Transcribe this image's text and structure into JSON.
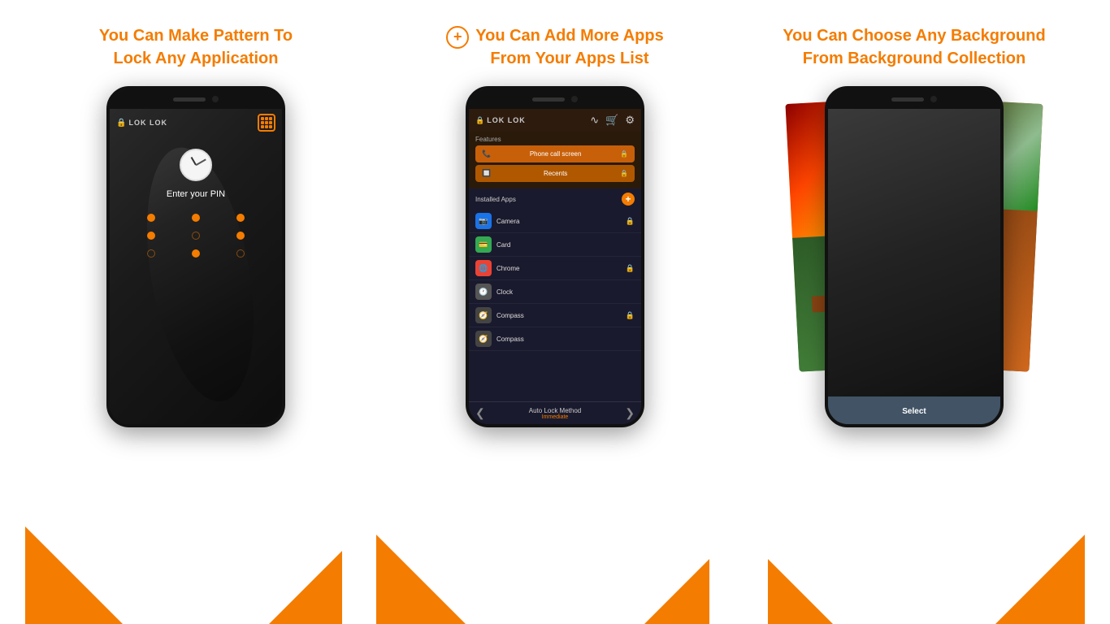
{
  "col1": {
    "title_line1": "You Can Make Pattern To",
    "title_line2": "Lock Any Application",
    "phone": {
      "app_name": "LOK LOK",
      "pin_prompt": "Enter your PIN",
      "dots": [
        "filled",
        "filled",
        "filled",
        "empty",
        "empty",
        "filled",
        "empty",
        "empty",
        "empty"
      ]
    }
  },
  "col2": {
    "title_prefix": "+",
    "title_line1": "You Can Add More Apps",
    "title_line2": "From Your Apps List",
    "features_label": "Features",
    "features": [
      {
        "name": "Phone call screen"
      },
      {
        "name": "Recents"
      }
    ],
    "installed_label": "Installed Apps",
    "apps": [
      {
        "name": "Camera",
        "color": "#1a73e8"
      },
      {
        "name": "Card",
        "color": "#34a853"
      },
      {
        "name": "Chrome",
        "color": "#ea4335"
      },
      {
        "name": "Clock",
        "color": "#555"
      },
      {
        "name": "Compass",
        "color": "#555"
      },
      {
        "name": "Compass",
        "color": "#555"
      }
    ],
    "auto_lock_label": "Auto Lock Method",
    "auto_lock_value": "Immediate"
  },
  "col3": {
    "title_line1": "You Can Choose Any Background",
    "title_line2": "From Background Collection",
    "select_btn": "Select"
  },
  "accent_color": "#f47c00"
}
